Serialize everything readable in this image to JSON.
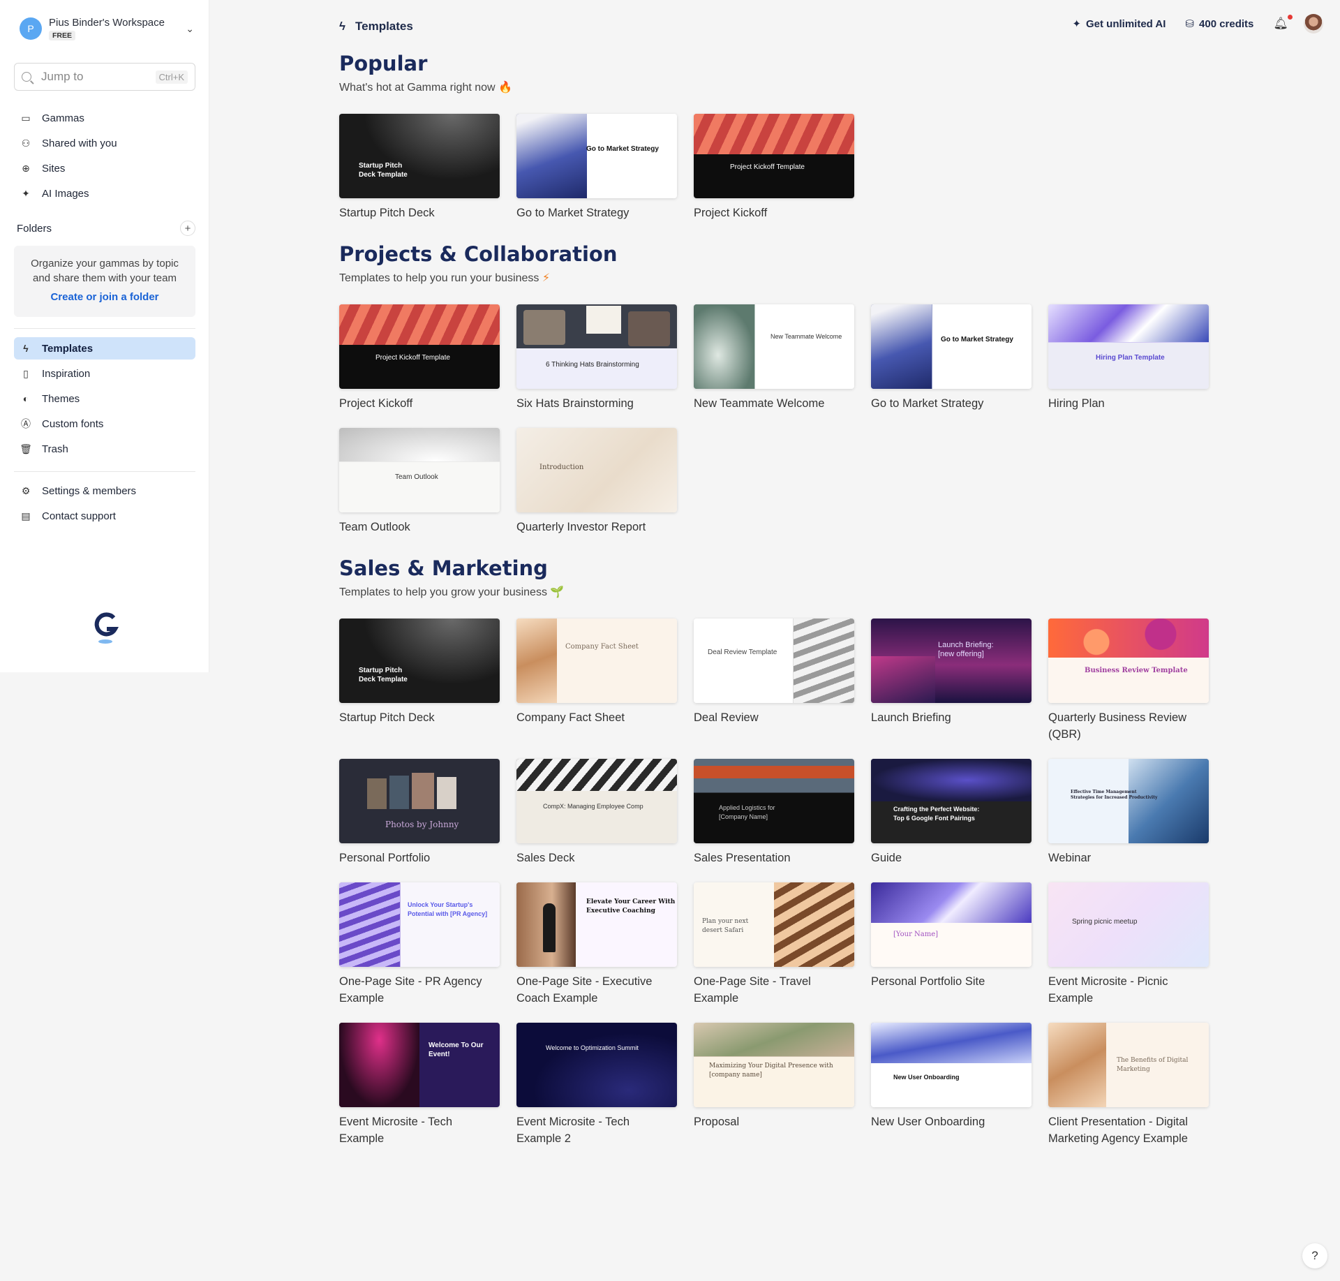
{
  "workspace": {
    "initial": "P",
    "name": "Pius Binder's Workspace",
    "plan": "FREE"
  },
  "search": {
    "placeholder": "Jump to",
    "shortcut": "Ctrl+K"
  },
  "nav_top": [
    {
      "label": "Gammas",
      "icon": "stack-icon"
    },
    {
      "label": "Shared with you",
      "icon": "people-icon"
    },
    {
      "label": "Sites",
      "icon": "globe-icon"
    },
    {
      "label": "AI Images",
      "icon": "sparkle-icon"
    }
  ],
  "folders": {
    "heading": "Folders",
    "empty_message": "Organize your gammas by topic and share them with your team",
    "create_link": "Create or join a folder"
  },
  "nav_mid": [
    {
      "label": "Templates",
      "icon": "bolt-icon",
      "active": true
    },
    {
      "label": "Inspiration",
      "icon": "book-icon"
    },
    {
      "label": "Themes",
      "icon": "palette-icon"
    },
    {
      "label": "Custom fonts",
      "icon": "font-icon"
    },
    {
      "label": "Trash",
      "icon": "trash-icon"
    }
  ],
  "nav_bottom": [
    {
      "label": "Settings & members",
      "icon": "settings-icon"
    },
    {
      "label": "Contact support",
      "icon": "chat-icon"
    }
  ],
  "header": {
    "title": "Templates",
    "upgrade": "Get unlimited AI",
    "credits": "400 credits",
    "help": "?"
  },
  "sections": [
    {
      "title": "Popular",
      "subtitle": "What's hot at Gamma right now",
      "emoji": "🔥",
      "cards": [
        {
          "label": "Startup Pitch Deck",
          "thumb_title": "Startup Pitch\nDeck Template"
        },
        {
          "label": "Go to Market Strategy",
          "thumb_title": "Go to Market Strategy"
        },
        {
          "label": "Project Kickoff",
          "thumb_title": "Project Kickoff Template"
        }
      ]
    },
    {
      "title": "Projects & Collaboration",
      "subtitle": "Templates to help you run your business",
      "emoji": "⚡",
      "cards": [
        {
          "label": "Project Kickoff",
          "thumb_title": "Project Kickoff Template"
        },
        {
          "label": "Six Hats Brainstorming",
          "thumb_title": "6 Thinking Hats Brainstorming"
        },
        {
          "label": "New Teammate Welcome",
          "thumb_title": "New Teammate Welcome"
        },
        {
          "label": "Go to Market Strategy",
          "thumb_title": "Go to Market Strategy"
        },
        {
          "label": "Hiring Plan",
          "thumb_title": "Hiring Plan Template"
        },
        {
          "label": "Team Outlook",
          "thumb_title": "Team Outlook"
        },
        {
          "label": "Quarterly Investor Report",
          "thumb_title": "Introduction"
        }
      ]
    },
    {
      "title": "Sales & Marketing",
      "subtitle": "Templates to help you grow your business",
      "emoji": "🌱",
      "cards": [
        {
          "label": "Startup Pitch Deck",
          "thumb_title": "Startup Pitch\nDeck Template"
        },
        {
          "label": "Company Fact Sheet",
          "thumb_title": "Company Fact Sheet"
        },
        {
          "label": "Deal Review",
          "thumb_title": "Deal Review Template"
        },
        {
          "label": "Launch Briefing",
          "thumb_title": "Launch Briefing:\n[new offering]"
        },
        {
          "label": "Quarterly Business Review (QBR)",
          "thumb_title": "Business Review Template"
        },
        {
          "label": "Personal Portfolio",
          "thumb_title": "Photos by Johnny"
        },
        {
          "label": "Sales Deck",
          "thumb_title": "CompX: Managing Employee Comp"
        },
        {
          "label": "Sales Presentation",
          "thumb_title": "Applied Logistics for\n[Company Name]"
        },
        {
          "label": "Guide",
          "thumb_title": "Crafting the Perfect Website:\nTop 6 Google Font Pairings"
        },
        {
          "label": "Webinar",
          "thumb_title": "Effective Time Management\nStrategies for Increased Productivity"
        },
        {
          "label": "One-Page Site - PR Agency Example",
          "thumb_title": "Unlock Your Startup's\nPotential with [PR Agency]"
        },
        {
          "label": "One-Page Site - Executive Coach Example",
          "thumb_title": "Elevate Your Career With\nExecutive Coaching"
        },
        {
          "label": "One-Page Site - Travel Example",
          "thumb_title": "Plan your next\ndesert Safari"
        },
        {
          "label": "Personal Portfolio Site",
          "thumb_title": "[Your Name]"
        },
        {
          "label": "Event Microsite - Picnic Example",
          "thumb_title": "Spring picnic meetup"
        },
        {
          "label": "Event Microsite - Tech Example",
          "thumb_title": "Welcome To Our\nEvent!"
        },
        {
          "label": "Event Microsite - Tech Example 2",
          "thumb_title": "Welcome to Optimization Summit"
        },
        {
          "label": "Proposal",
          "thumb_title": "Maximizing Your Digital Presence with\n[company name]"
        },
        {
          "label": "New User Onboarding",
          "thumb_title": "New User Onboarding"
        },
        {
          "label": "Client Presentation - Digital Marketing Agency Example",
          "thumb_title": "The Benefits of Digital\nMarketing"
        }
      ]
    }
  ],
  "colors": {
    "accent": "#1a63d6",
    "active_nav": "#cfe3fa",
    "heading": "#1a2a5c"
  }
}
